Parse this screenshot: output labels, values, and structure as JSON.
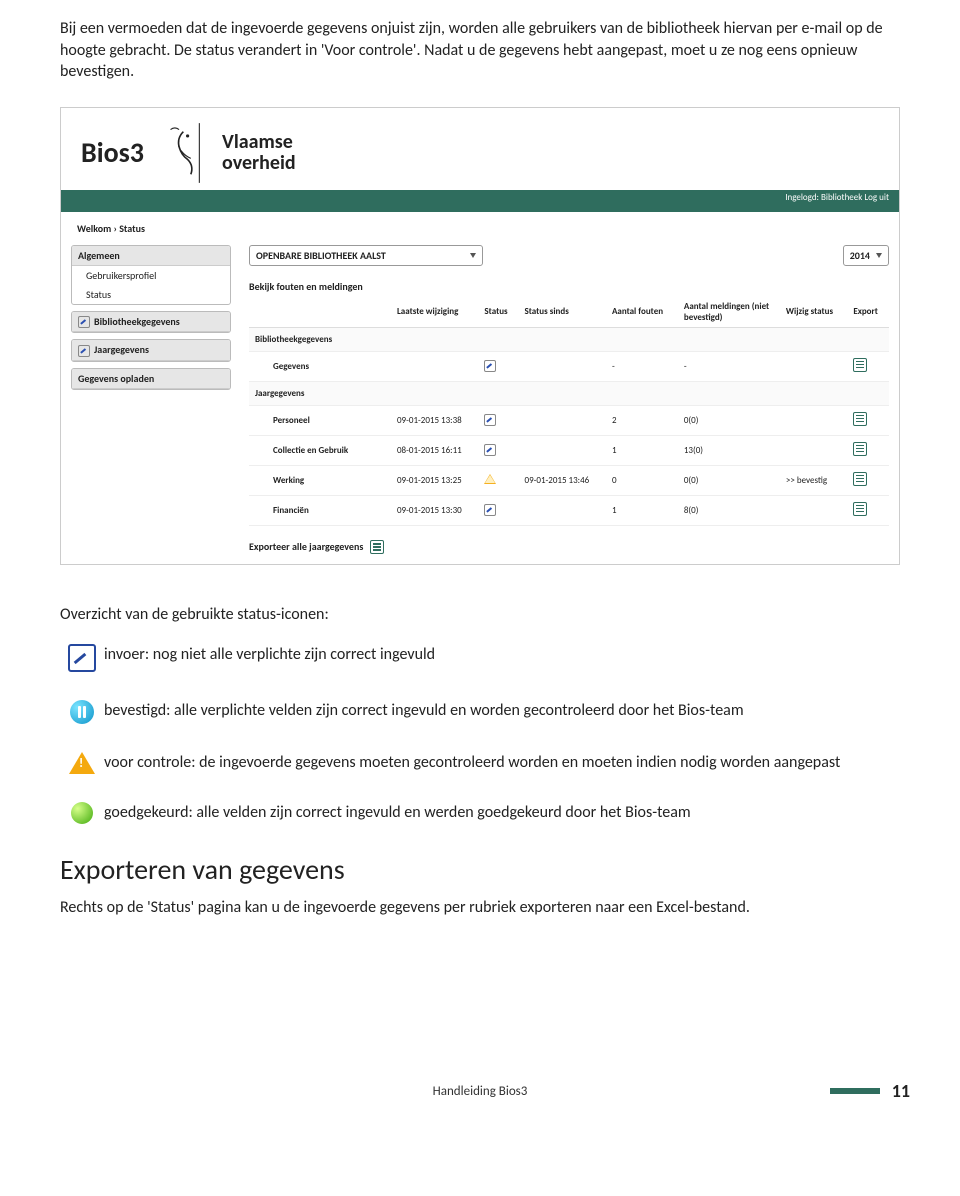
{
  "doc": {
    "intro": "Bij een vermoeden dat de ingevoerde gegevens onjuist zijn, worden alle gebruikers van de bibliotheek hiervan per e-mail op de hoogte gebracht. De status verandert in 'Voor controle'. Nadat u de gegevens hebt aangepast, moet u ze nog eens opnieuw bevestigen.",
    "status_title": "Overzicht van de gebruikte status-iconen:",
    "legend": {
      "invoer": "invoer: nog niet alle verplichte zijn correct ingevuld",
      "bevestigd": "bevestigd: alle verplichte velden zijn correct ingevuld en worden gecontroleerd door het Bios-team",
      "controle": "voor controle: de ingevoerde gegevens moeten gecontroleerd worden en moeten indien nodig worden aangepast",
      "goedgekeurd": "goedgekeurd: alle velden zijn correct ingevuld en werden goedgekeurd door het Bios-team"
    },
    "export_heading": "Exporteren van gegevens",
    "export_text": "Rechts op de 'Status' pagina kan u de ingevoerde gegevens per rubriek exporteren naar een Excel-bestand.",
    "footer_text": "Handleiding Bios3",
    "page_no": "11"
  },
  "app": {
    "name": "Bios3",
    "org_line1": "Vlaamse",
    "org_line2": "overheid",
    "topbar": "Ingelogd: Bibliotheek Log uit",
    "crumbs": "Welkom › Status",
    "sidebar": {
      "g1_head": "Algemeen",
      "g1_items": [
        "Gebruikersprofiel",
        "Status"
      ],
      "g2": "Bibliotheekgegevens",
      "g3": "Jaargegevens",
      "g4": "Gegevens opladen"
    },
    "lib_name": "OPENBARE BIBLIOTHEEK AALST",
    "year": "2014",
    "sub1": "Bekijk fouten en meldingen",
    "headers": {
      "c0": "",
      "c1": "Laatste wijziging",
      "c2": "Status",
      "c3": "Status sinds",
      "c4": "Aantal fouten",
      "c5": "Aantal meldingen (niet bevestigd)",
      "c6": "Wijzig status",
      "c7": "Export"
    },
    "section1": "Bibliotheekgegevens",
    "row_geg": {
      "name": "Gegevens",
      "lw": "",
      "since": "",
      "fouten": "-",
      "meld": "-",
      "wijzig": ""
    },
    "section2": "Jaargegevens",
    "rows": [
      {
        "name": "Personeel",
        "lw": "09-01-2015 13:38",
        "status": "pencil",
        "since": "",
        "fouten": "2",
        "meld": "0(0)",
        "wijzig": ""
      },
      {
        "name": "Collectie en Gebruik",
        "lw": "08-01-2015 16:11",
        "status": "pencil",
        "since": "",
        "fouten": "1",
        "meld": "13(0)",
        "wijzig": ""
      },
      {
        "name": "Werking",
        "lw": "09-01-2015 13:25",
        "status": "warn",
        "since": "09-01-2015 13:46",
        "fouten": "0",
        "meld": "0(0)",
        "wijzig": ">> bevestig"
      },
      {
        "name": "Financiën",
        "lw": "09-01-2015 13:30",
        "status": "pencil",
        "since": "",
        "fouten": "1",
        "meld": "8(0)",
        "wijzig": ""
      }
    ],
    "export_all": "Exporteer alle jaargegevens"
  }
}
